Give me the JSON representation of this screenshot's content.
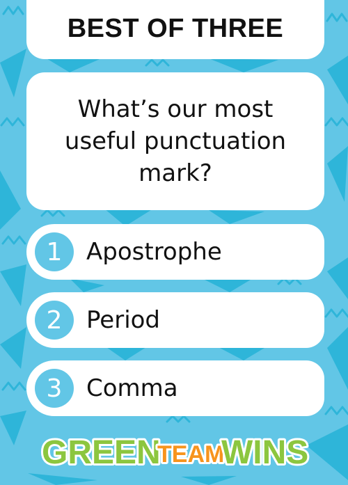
{
  "header": {
    "title": "BEST OF THREE"
  },
  "question": {
    "text": "What’s our most useful punctuation mark?"
  },
  "answers": [
    {
      "number": "1",
      "label": "Apostrophe"
    },
    {
      "number": "2",
      "label": "Period"
    },
    {
      "number": "3",
      "label": "Comma"
    }
  ],
  "logo": {
    "word1": "GREEN",
    "word2": "TEAM",
    "word3": "WINS"
  },
  "colors": {
    "background": "#62c6e6",
    "pattern": "#2eb5d9",
    "card": "#ffffff",
    "logo_green": "#8cc63f",
    "logo_orange": "#f7941d"
  }
}
